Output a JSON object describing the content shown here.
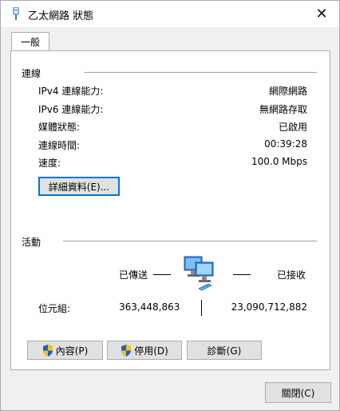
{
  "window": {
    "title": "乙太網路 狀態",
    "close_glyph": "✕"
  },
  "tabs": [
    {
      "label": "一般"
    }
  ],
  "connection": {
    "section_title": "連線",
    "rows": [
      {
        "label": "IPv4 連線能力:",
        "value": "網際網路"
      },
      {
        "label": "IPv6 連線能力:",
        "value": "無網路存取"
      },
      {
        "label": "媒體狀態:",
        "value": "已啟用"
      },
      {
        "label": "連線時間:",
        "value": "00:39:28"
      },
      {
        "label": "速度:",
        "value": "100.0 Mbps"
      }
    ],
    "details_button": "詳細資料(E)..."
  },
  "activity": {
    "section_title": "活動",
    "sent_label": "已傳送",
    "received_label": "已接收",
    "bytes_label": "位元組:",
    "bytes_sent": "363,448,863",
    "bytes_received": "23,090,712,882"
  },
  "actions": {
    "properties": "內容(P)",
    "disable": "停用(D)",
    "diagnose": "診斷(G)"
  },
  "footer": {
    "close_button": "關閉(C)"
  },
  "icons": {
    "app": "ethernet-cable-icon",
    "network": "network-computers-icon",
    "shield": "uac-shield-icon"
  },
  "colors": {
    "focus_border": "#0078d7",
    "shield_blue": "#1f5fbf",
    "shield_yellow": "#f3c21a"
  }
}
